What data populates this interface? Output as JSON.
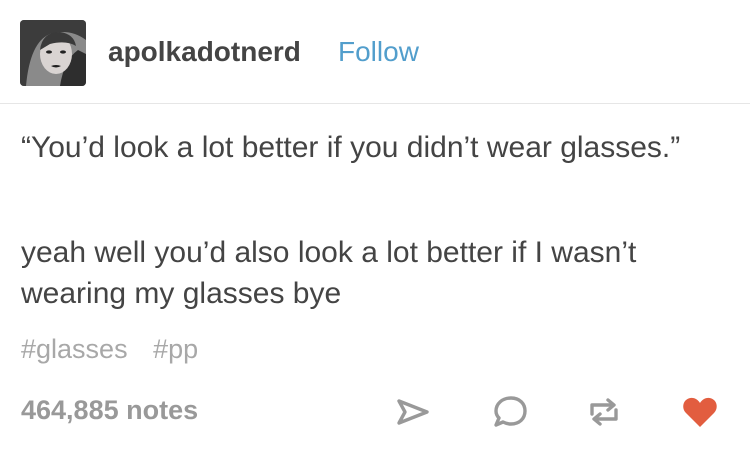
{
  "post": {
    "author": {
      "username": "apolkadotnerd",
      "follow_label": "Follow"
    },
    "paragraphs": [
      "“You’d look a lot better if you didn’t wear glasses.”",
      "yeah well you’d also look a lot better if I wasn’t wearing my glasses bye"
    ],
    "tags": [
      "#glasses",
      "#pp"
    ],
    "notes": "464,885 notes",
    "actions": {
      "share_icon": "share-icon",
      "reply_icon": "reply-icon",
      "reblog_icon": "reblog-icon",
      "like_icon": "heart-icon"
    }
  },
  "colors": {
    "text": "#444444",
    "follow": "#529ecc",
    "tags": "#a8a8a8",
    "notes": "#999999",
    "icons": "#999999",
    "like": "#e25d3f"
  }
}
